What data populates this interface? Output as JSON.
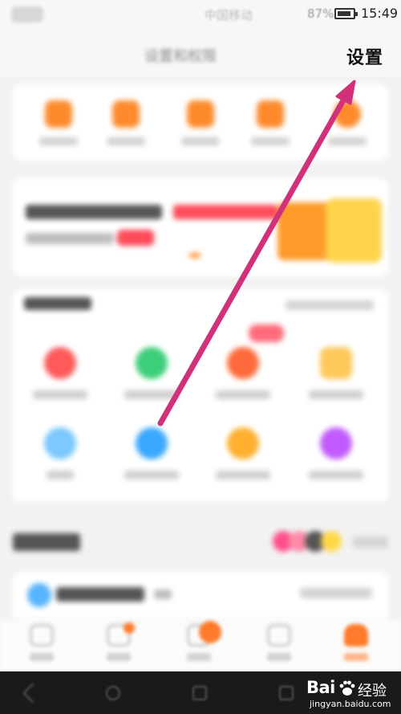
{
  "status_bar": {
    "carrier": "中国移动",
    "battery_percent": "87%",
    "time": "15:49"
  },
  "header": {
    "title": "设置和权限",
    "settings_label": "设置"
  },
  "quick_actions": [
    "我的订单",
    "我的收藏",
    "我的足迹",
    "卡券",
    "我的红包"
  ],
  "promo": {
    "headline": "和朋友一起分享领红包",
    "highlight": "最高1000元",
    "subline": "邀请好友得奖励",
    "tag": "立即"
  },
  "tools": {
    "title": "常用工具",
    "more_label": "查看全部工具",
    "items": [
      {
        "label": "小程序",
        "color": "#ff5a5a"
      },
      {
        "label": "客服",
        "color": "#3ccf7a"
      },
      {
        "label": "活动",
        "color": "#ff6a3a"
      },
      {
        "label": "我的钱包",
        "color": "#ffc85a"
      },
      {
        "label": "设置",
        "color": "#7cc8ff"
      },
      {
        "label": "消息",
        "color": "#3aa8ff"
      },
      {
        "label": "权益中心",
        "color": "#ffb02e"
      },
      {
        "label": "更多服务",
        "color": "#c25bff"
      }
    ]
  },
  "section": {
    "title": "推荐",
    "circle_colors": [
      "#ff4f8a",
      "#ff8aa8",
      "#555555",
      "#ffd84a"
    ]
  },
  "mini_card": {
    "title": "精彩推荐",
    "more": "更多内容"
  },
  "tabbar": {
    "items": [
      "首页",
      "推荐",
      "消息",
      "购物车",
      "我的"
    ],
    "active_color": "#ff7a2b"
  },
  "watermark": {
    "brand": "Bai",
    "suffix": "经验",
    "url": "jingyan.baidu.com"
  },
  "annotation_color": "#d0317a"
}
